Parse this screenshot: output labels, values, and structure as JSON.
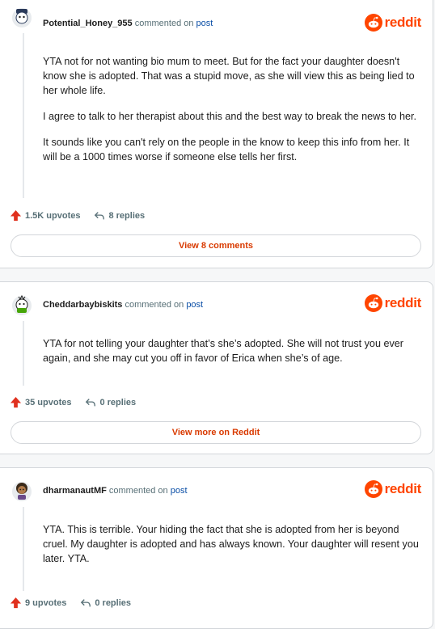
{
  "brand": {
    "logo_text": "reddit",
    "color": "#ff4500"
  },
  "comments": [
    {
      "username": "Potential_Honey_955",
      "commented_on": "commented on",
      "post_link": "post",
      "paragraphs": [
        "YTA not for not wanting bio mum to meet. But for the fact your daughter doesn't know she is adopted. That was a stupid move, as she will view this as being lied to her whole life.",
        "I agree to talk to her therapist about this and the best way to break the news to her.",
        "It sounds like you can't rely on the people in the know to keep this info from her. It will be a 1000 times worse if someone else tells her first."
      ],
      "upvotes": "1.5K upvotes",
      "replies": "8 replies",
      "button": "View 8 comments"
    },
    {
      "username": "Cheddarbaybiskits",
      "commented_on": "commented on",
      "post_link": "post",
      "paragraphs": [
        "YTA for not telling your daughter that’s she’s adopted. She will not trust you ever again, and she may cut you off in favor of Erica when she’s of age."
      ],
      "upvotes": "35 upvotes",
      "replies": "0 replies",
      "button": "View more on Reddit"
    },
    {
      "username": "dharmanautMF",
      "commented_on": "commented on",
      "post_link": "post",
      "paragraphs": [
        "YTA. This is terrible. Your hiding the fact that she is adopted from her is beyond cruel. My daughter is adopted and has always known. Your daughter will resent you later. YTA."
      ],
      "upvotes": "9 upvotes",
      "replies": "0 replies"
    }
  ]
}
